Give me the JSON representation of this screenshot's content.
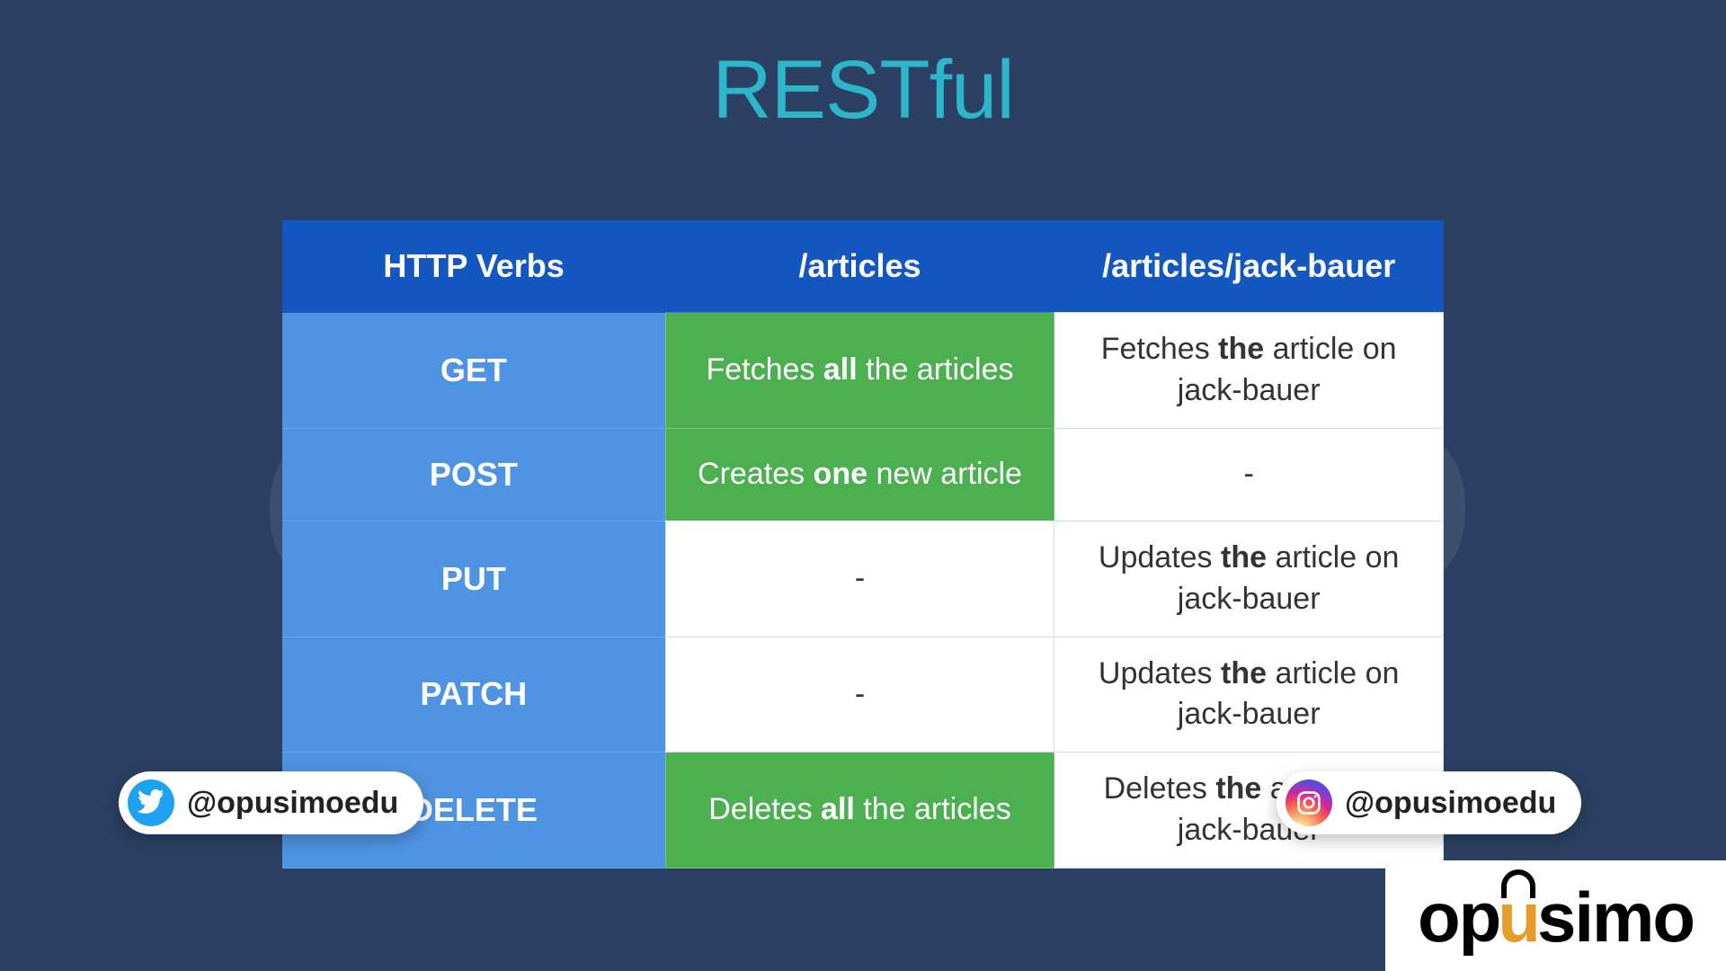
{
  "title": "RESTful",
  "watermark": "opusimo",
  "table": {
    "headers": [
      "HTTP Verbs",
      "/articles",
      "/articles/jack-bauer"
    ],
    "rows": [
      {
        "verb": "GET",
        "col1": {
          "pre": "Fetches ",
          "bold": "all",
          "post": " the articles",
          "hl": true
        },
        "col2": {
          "pre": "Fetches ",
          "bold": "the",
          "post": " article on jack-bauer",
          "hl": false
        }
      },
      {
        "verb": "POST",
        "col1": {
          "pre": "Creates ",
          "bold": "one",
          "post": " new article",
          "hl": true
        },
        "col2": {
          "pre": "-",
          "bold": "",
          "post": "",
          "hl": false
        }
      },
      {
        "verb": "PUT",
        "col1": {
          "pre": "-",
          "bold": "",
          "post": "",
          "hl": false
        },
        "col2": {
          "pre": "Updates ",
          "bold": "the",
          "post": " article on jack-bauer",
          "hl": false
        }
      },
      {
        "verb": "PATCH",
        "col1": {
          "pre": "-",
          "bold": "",
          "post": "",
          "hl": false
        },
        "col2": {
          "pre": "Updates ",
          "bold": "the",
          "post": " article on jack-bauer",
          "hl": false
        }
      },
      {
        "verb": "DELETE",
        "col1": {
          "pre": "Deletes ",
          "bold": "all",
          "post": " the articles",
          "hl": true
        },
        "col2": {
          "pre": "Deletes ",
          "bold": "the",
          "post": " article on jack-bauer",
          "hl": false
        }
      }
    ]
  },
  "social": {
    "twitter": "@opusimoedu",
    "instagram": "@opusimoedu"
  },
  "logo": {
    "pre": "op",
    "u": "u",
    "post": "simo"
  }
}
